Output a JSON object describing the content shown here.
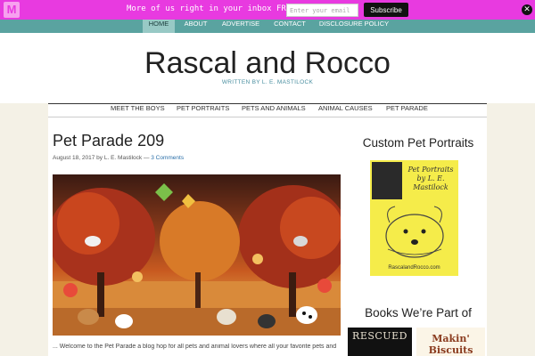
{
  "promo": {
    "logo": "M",
    "text": "More of us right in your inbox FREE -->",
    "email_placeholder": "Enter your email",
    "subscribe_label": "Subscribe",
    "close_glyph": "✕"
  },
  "top_nav": {
    "items": [
      "HOME",
      "ABOUT",
      "ADVERTISE",
      "CONTACT",
      "DISCLOSURE POLICY"
    ],
    "active_index": 0
  },
  "header": {
    "title": "Rascal and Rocco",
    "description": "WRITTEN BY L. E. MASTILOCK"
  },
  "main_nav": {
    "items": [
      "MEET THE BOYS",
      "PET PORTRAITS",
      "PETS AND ANIMALS",
      "ANIMAL CAUSES",
      "PET PARADE"
    ]
  },
  "post": {
    "title": "Pet Parade 209",
    "date": "August 18, 2017",
    "by": "by",
    "author": "L. E. Mastilock",
    "separator": "—",
    "comments": "3 Comments",
    "excerpt": "... Welcome to the Pet Parade a blog hop for all pets and animal lovers where all your favorite pets and"
  },
  "sidebar": {
    "portraits_heading": "Custom Pet Portraits",
    "portrait_caption": "Pet Portraits by L. E. Mastilock",
    "portrait_site": "RascalandRocco.com",
    "books_heading": "Books We’re Part of",
    "book1_title": "RESCUED",
    "book2_title": "Makin' Biscuits"
  },
  "colors": {
    "promo_bg": "#e83ae0",
    "nav_bg": "#5aa3a0",
    "accent_text": "#4a8fa0",
    "link": "#2a6fa8"
  }
}
